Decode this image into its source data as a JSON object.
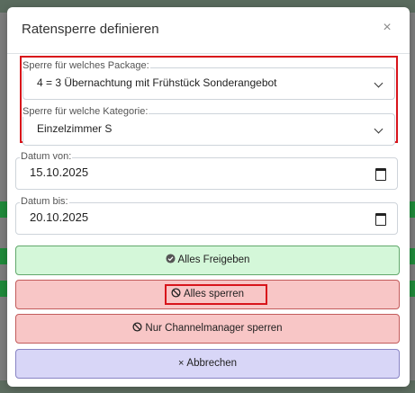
{
  "dialog": {
    "title": "Ratensperre definieren",
    "close_glyph": "×"
  },
  "fields": {
    "package": {
      "label": "Sperre für welches Package:",
      "value": "4 = 3 Übernachtung mit Frühstück Sonderangebot"
    },
    "category": {
      "label": "Sperre für welche Kategorie:",
      "value": "Einzelzimmer S"
    },
    "date_from": {
      "label": "Datum von:",
      "value": "15.10.2025"
    },
    "date_to": {
      "label": "Datum bis:",
      "value": "20.10.2025"
    }
  },
  "buttons": {
    "release_all": {
      "label": "Alles Freigeben",
      "color": "#d4f7d9",
      "icon": "check-circle-icon"
    },
    "block_all": {
      "label": "Alles sperren",
      "color": "#f8c6c6",
      "icon": "ban-icon"
    },
    "block_channel": {
      "label": "Nur Channelmanager sperren",
      "color": "#f8c6c6",
      "icon": "ban-icon"
    },
    "cancel": {
      "label": "Abbrechen",
      "color": "#d8d6f7",
      "icon": "x-icon",
      "glyph": "×"
    }
  },
  "colors": {
    "highlight": "#d8141b"
  }
}
